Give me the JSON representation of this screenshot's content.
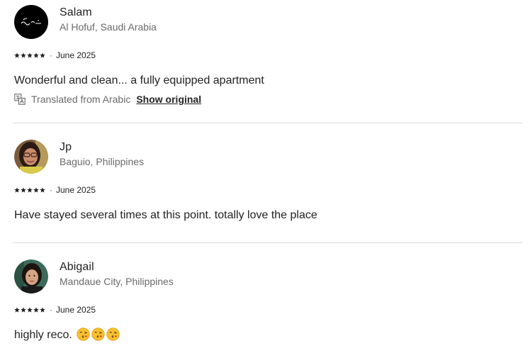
{
  "reviews": [
    {
      "name": "Salam",
      "location": "Al Hofuf, Saudi Arabia",
      "rating": 5,
      "dot": "·",
      "date": "June 2025",
      "text": "Wonderful and clean... a fully equipped apartment",
      "translation": {
        "label": "Translated from Arabic",
        "action": "Show original",
        "icon": "translate-icon"
      },
      "avatar": "avatar-black-calligraphy"
    },
    {
      "name": "Jp",
      "location": "Baguio, Philippines",
      "rating": 5,
      "dot": "·",
      "date": "June 2025",
      "text": "Have stayed several times at this point. totally love the place",
      "avatar": "avatar-photo-woman-glasses"
    },
    {
      "name": "Abigail",
      "location": "Mandaue City, Philippines",
      "rating": 5,
      "dot": "·",
      "date": "June 2025",
      "text": "highly reco.",
      "emojis": [
        "kissing-face-emoji",
        "kissing-face-emoji",
        "kissing-face-emoji"
      ],
      "avatar": "avatar-photo-woman"
    }
  ],
  "colors": {
    "text": "#222222",
    "muted": "#6a6a6a",
    "divider": "#dddddd"
  }
}
